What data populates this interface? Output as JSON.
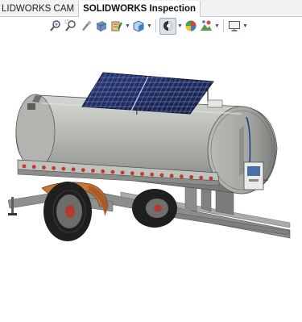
{
  "tabs": [
    {
      "label": "LIDWORKS CAM",
      "active": false
    },
    {
      "label": "SOLIDWORKS Inspection",
      "active": true
    }
  ],
  "toolbar": {
    "icons": [
      "zoom-to-fit-icon",
      "zoom-to-area-icon",
      "previous-view-icon",
      "section-view-icon",
      "dynamic-annotation-icon",
      "view-orientation-icon",
      "display-style-icon",
      "hide-show-items-icon",
      "edit-appearance-icon",
      "apply-scene-icon",
      "view-settings-icon"
    ],
    "active_icon": "display-style-icon"
  },
  "model": {
    "description": "3D trailer-mounted tank with solar panels",
    "colors": {
      "tank": "#a8aba7",
      "frame": "#8d908c",
      "fender": "#c9743a",
      "solar": "#1c2a5e",
      "reflector": "#c0392b"
    }
  }
}
